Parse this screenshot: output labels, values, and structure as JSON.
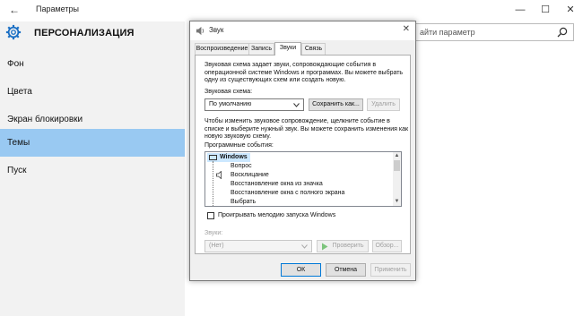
{
  "settings": {
    "window_title": "Параметры",
    "section_title": "ПЕРСОНАЛИЗАЦИЯ",
    "search_placeholder": "айти параметр",
    "nav": [
      {
        "label": "Фон"
      },
      {
        "label": "Цвета"
      },
      {
        "label": "Экран блокировки"
      },
      {
        "label": "Темы",
        "active": true
      },
      {
        "label": "Пуск"
      }
    ],
    "accent_color": "#99c9f2"
  },
  "dialog": {
    "title": "Звук",
    "tabs": [
      "Воспроизведение",
      "Запись",
      "Звуки",
      "Связь"
    ],
    "active_tab": "Звуки",
    "description": "Звуковая схема задает звуки, сопровождающие события в операционной системе Windows и программах. Вы можете выбрать одну из существующих схем или создать новую.",
    "scheme_label": "Звуковая схема:",
    "scheme_value": "По умолчанию",
    "save_as_label": "Сохранить как...",
    "delete_label": "Удалить",
    "change_description": "Чтобы изменить звуковое сопровождение, щелкните событие в списке и выберите нужный звук. Вы можете сохранить изменения как новую звуковую схему.",
    "events_label": "Программные события:",
    "events": {
      "group": "Windows",
      "items": [
        {
          "label": "Вопрос",
          "has_sound": false
        },
        {
          "label": "Восклицание",
          "has_sound": true
        },
        {
          "label": "Восстановление окна из значка",
          "has_sound": false
        },
        {
          "label": "Восстановление окна с полного экрана",
          "has_sound": false
        },
        {
          "label": "Выбрать",
          "has_sound": false
        }
      ]
    },
    "startup_checkbox_label": "Проигрывать мелодию запуска Windows",
    "startup_checked": false,
    "sounds_label": "Звуки:",
    "sound_value": "(Нет)",
    "test_label": "Проверить",
    "browse_label": "Обзор...",
    "ok_label": "ОК",
    "cancel_label": "Отмена",
    "apply_label": "Применить"
  }
}
